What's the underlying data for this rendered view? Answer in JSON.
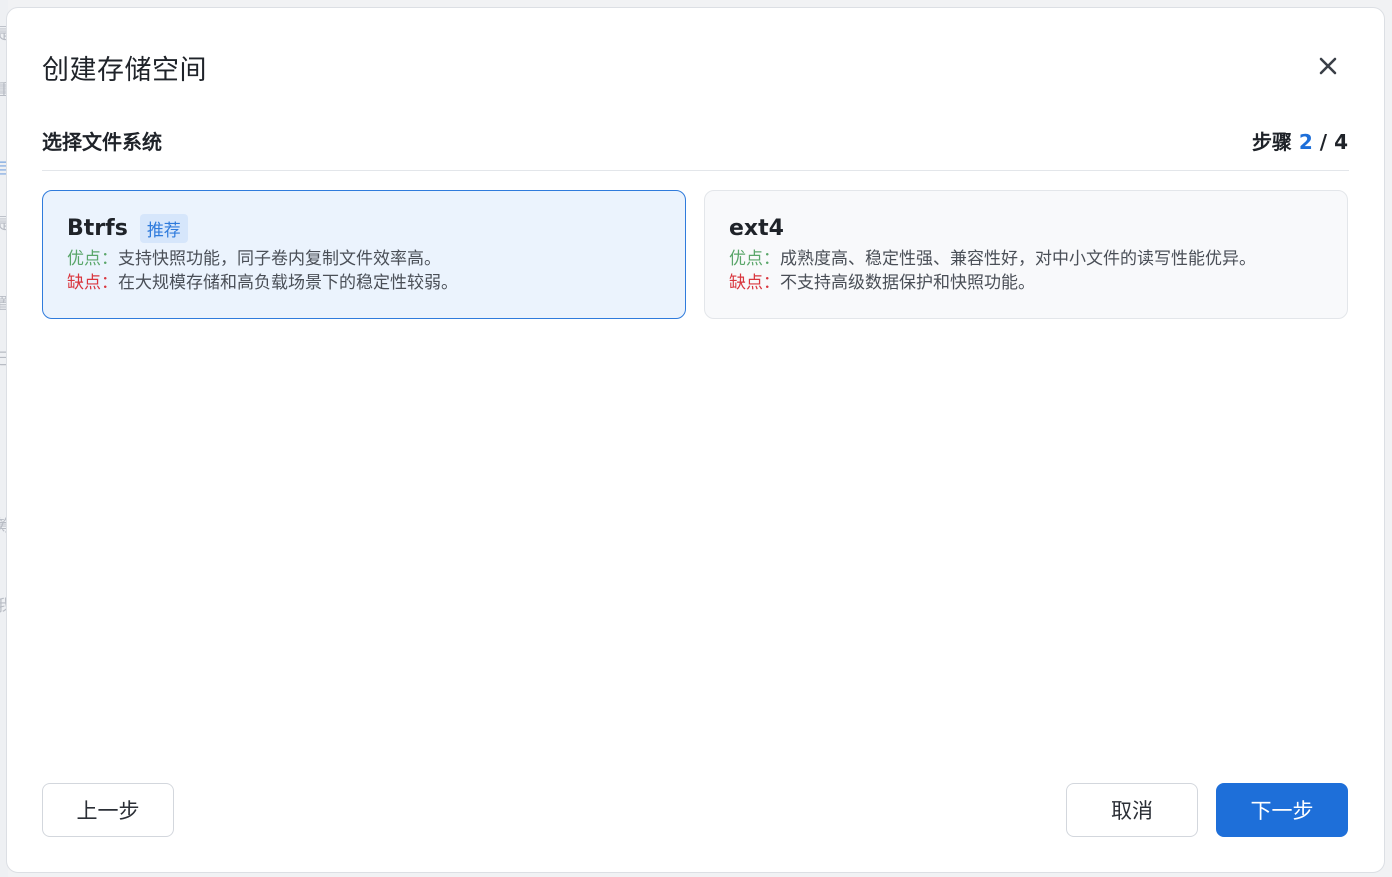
{
  "background": {
    "glyphs": [
      "是",
      "重",
      "目",
      "是",
      "置",
      "己",
      "筹",
      "我"
    ]
  },
  "dialog": {
    "title": "创建存储空间",
    "close_icon": "close-icon"
  },
  "section": {
    "title": "选择文件系统",
    "step_label": "步骤",
    "step_current": "2",
    "step_separator": "/",
    "step_total": "4"
  },
  "options": [
    {
      "name": "Btrfs",
      "badge": "推荐",
      "selected": true,
      "pros_label": "优点：",
      "pros": "支持快照功能，同子卷内复制文件效率高。",
      "cons_label": "缺点：",
      "cons": "在大规模存储和高负载场景下的稳定性较弱。"
    },
    {
      "name": "ext4",
      "badge": "",
      "selected": false,
      "pros_label": "优点：",
      "pros": "成熟度高、稳定性强、兼容性好，对中小文件的读写性能优异。",
      "cons_label": "缺点：",
      "cons": "不支持高级数据保护和快照功能。"
    }
  ],
  "footer": {
    "prev_label": "上一步",
    "cancel_label": "取消",
    "next_label": "下一步"
  },
  "colors": {
    "accent": "#1e6fd9",
    "pros": "#5aa66a",
    "cons": "#d9363e"
  }
}
